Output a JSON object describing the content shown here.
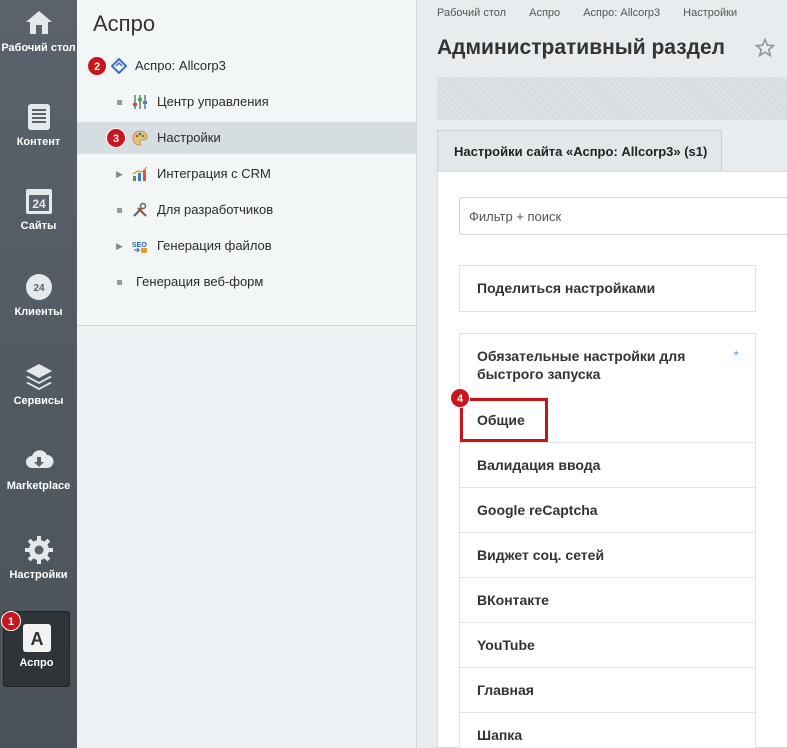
{
  "rail": [
    {
      "label": "Рабочий стол",
      "icon": "home-icon"
    },
    {
      "label": "Контент",
      "icon": "document-icon"
    },
    {
      "label": "Сайты",
      "icon": "calendar-24-icon"
    },
    {
      "label": "Клиенты",
      "icon": "cloud-24-icon"
    },
    {
      "label": "Сервисы",
      "icon": "layers-icon"
    },
    {
      "label": "Marketplace",
      "icon": "cloud-download-icon"
    },
    {
      "label": "Настройки",
      "icon": "gear-icon"
    },
    {
      "label": "Аспро",
      "icon": "aspro-a-icon",
      "active": true
    }
  ],
  "badges": [
    "1",
    "2",
    "3",
    "4"
  ],
  "menu": {
    "title": "Аспро",
    "items": [
      {
        "label": "Аспро: Allcorp3",
        "icon": "aspro-logo-icon"
      },
      {
        "label": "Центр управления",
        "icon": "sliders-icon"
      },
      {
        "label": "Настройки",
        "icon": "palette-icon",
        "selected": true
      },
      {
        "label": "Интеграция с CRM",
        "icon": "chart-icon"
      },
      {
        "label": "Для разработчиков",
        "icon": "tools-icon"
      },
      {
        "label": "Генерация файлов",
        "icon": "seo-icon"
      },
      {
        "label": "Генерация веб-форм"
      }
    ]
  },
  "breadcrumbs": [
    "Рабочий стол",
    "Аспро",
    "Аспро: Allcorp3",
    "Настройки"
  ],
  "page_title": "Административный раздел",
  "tab_label": "Настройки сайта «Аспро: Allcorp3» (s1)",
  "filter_placeholder": "Фильтр + поиск",
  "share_label": "Поделиться настройками",
  "settings_sections": [
    "Обязательные настройки для быстрого запуска",
    "Общие",
    "Валидация ввода",
    "Google reCaptcha",
    "Виджет соц. сетей",
    "ВКонтакте",
    "YouTube",
    "Главная",
    "Шапка"
  ],
  "required_marker": "*",
  "colors": {
    "badge": "#c8161d",
    "highlight": "#c0161d",
    "rail": "#515a61"
  }
}
